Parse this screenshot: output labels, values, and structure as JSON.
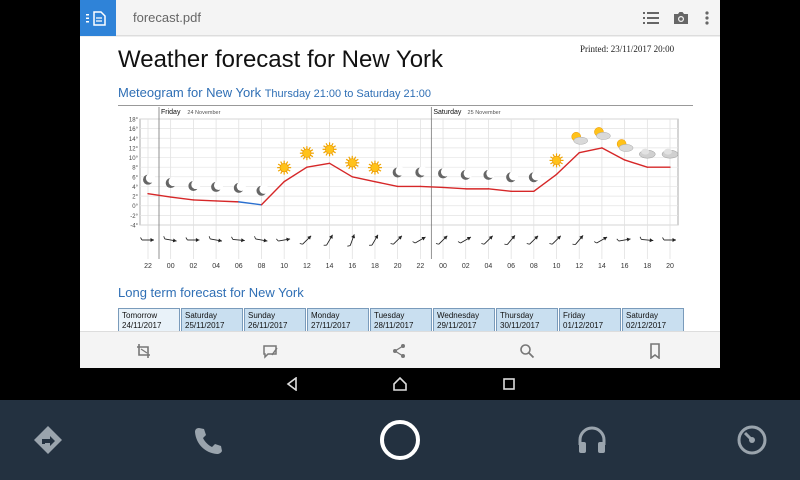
{
  "app": {
    "file_name": "forecast.pdf",
    "icons": [
      "menu-icon",
      "document-icon",
      "list-icon",
      "camera-icon",
      "more-vert-icon"
    ]
  },
  "document": {
    "title": "Weather forecast for New York",
    "printed": "Printed: 23/11/2017 20:00",
    "meteogram_title": "Meteogram for New York",
    "meteogram_subtitle": "Thursday 21:00 to Saturday 21:00",
    "long_term_title": "Long term forecast for New York",
    "days": [
      {
        "name": "Tomorrow",
        "date": "24/11/2017"
      },
      {
        "name": "Saturday",
        "date": "25/11/2017"
      },
      {
        "name": "Sunday",
        "date": "26/11/2017"
      },
      {
        "name": "Monday",
        "date": "27/11/2017"
      },
      {
        "name": "Tuesday",
        "date": "28/11/2017"
      },
      {
        "name": "Wednesday",
        "date": "29/11/2017"
      },
      {
        "name": "Thursday",
        "date": "30/11/2017"
      },
      {
        "name": "Friday",
        "date": "01/12/2017"
      },
      {
        "name": "Saturday",
        "date": "02/12/2017"
      }
    ]
  },
  "chart_data": {
    "type": "line",
    "title": "",
    "day_labels": [
      {
        "day": "Friday",
        "date": "24 November"
      },
      {
        "day": "Saturday",
        "date": "25 November"
      }
    ],
    "x": [
      "22",
      "00",
      "02",
      "04",
      "06",
      "08",
      "10",
      "12",
      "14",
      "16",
      "18",
      "20",
      "22",
      "00",
      "02",
      "04",
      "06",
      "08",
      "10",
      "12",
      "14",
      "16",
      "18",
      "20"
    ],
    "y_ticks": [
      "18°",
      "16°",
      "14°",
      "12°",
      "10°",
      "8°",
      "6°",
      "4°",
      "2°",
      "0°",
      "-2°",
      "-4°"
    ],
    "ylim": [
      -4,
      18
    ],
    "series": [
      {
        "values": [
          2.5,
          1.8,
          1.2,
          1,
          0.8,
          0.2,
          5,
          8,
          8.8,
          6,
          5,
          4,
          4,
          3.8,
          3.5,
          3.5,
          3,
          3,
          6.5,
          11,
          12,
          9.5,
          8,
          8
        ]
      }
    ],
    "colors": {
      "warm": "#d62728",
      "cold": "#2a6fcf"
    },
    "weather_icons": [
      "moon",
      "moon",
      "moon",
      "moon",
      "moon",
      "moon",
      "sun",
      "sun",
      "sun",
      "sun",
      "sun",
      "moon",
      "moon",
      "moon",
      "moon",
      "moon",
      "moon",
      "moon",
      "sun",
      "partly-cloudy",
      "partly-cloudy",
      "partly-cloudy",
      "cloudy",
      "cloudy"
    ],
    "wind_directions": [
      90,
      100,
      90,
      100,
      95,
      100,
      80,
      45,
      30,
      20,
      30,
      45,
      60,
      45,
      60,
      45,
      40,
      45,
      45,
      40,
      60,
      80,
      95,
      90
    ],
    "grid": true
  },
  "bottom_toolbar": {
    "icons": [
      "crop-icon",
      "annotate-icon",
      "share-icon",
      "search-icon",
      "bookmark-icon"
    ]
  },
  "android_nav": {
    "icons": [
      "back-icon",
      "home-icon",
      "recents-icon"
    ]
  },
  "dock": {
    "icons": [
      "navigation-icon",
      "phone-icon",
      "home-circle-icon",
      "headphones-icon",
      "speedometer-icon"
    ]
  }
}
